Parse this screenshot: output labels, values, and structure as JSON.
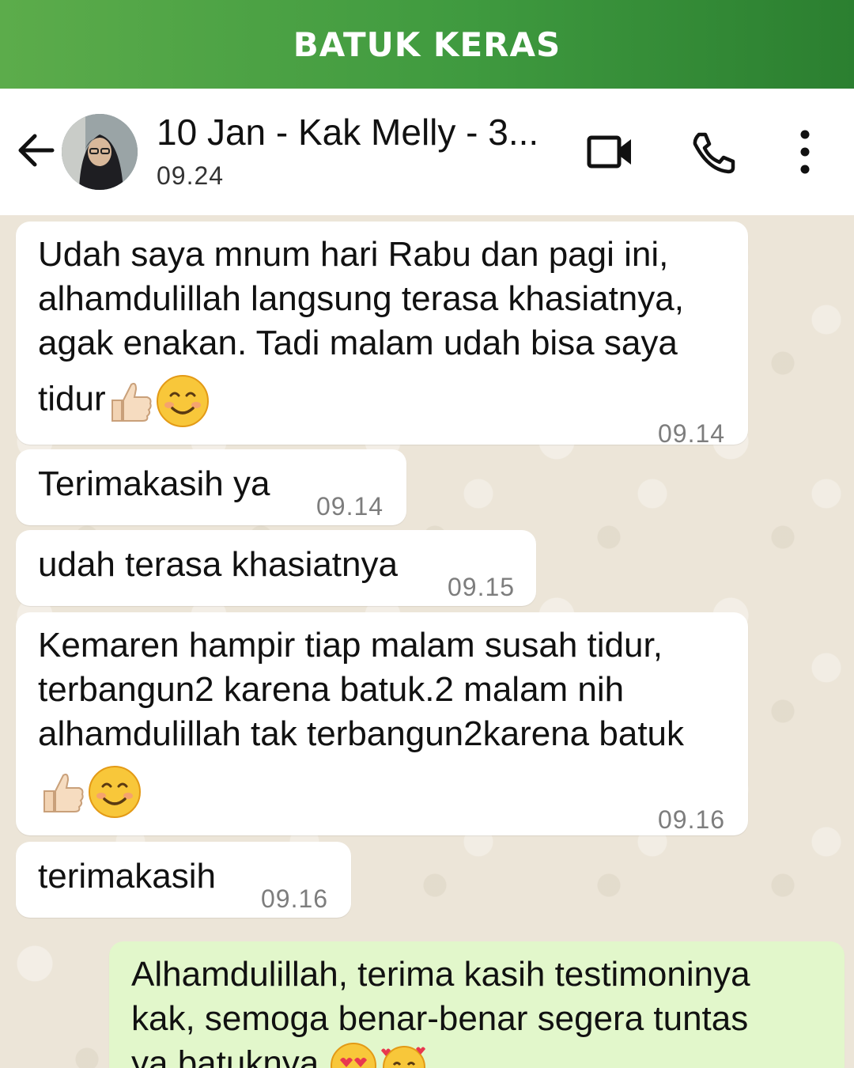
{
  "banner": {
    "title": "BATUK KERAS"
  },
  "header": {
    "contact_name": "10 Jan - Kak Melly - 3...",
    "last_seen": "09.24",
    "icons": [
      "back-arrow-icon",
      "video-call-icon",
      "phone-icon",
      "more-vert-icon"
    ]
  },
  "messages": [
    {
      "direction": "incoming",
      "lines": [
        "Udah saya mnum hari Rabu dan pagi ini,",
        "alhamdulillah langsung terasa khasiatnya,",
        "agak enakan. Tadi malam udah bisa saya",
        "tidur"
      ],
      "emojis": [
        "thumbs-up-icon",
        "smiling-face-icon"
      ],
      "time": "09.14"
    },
    {
      "direction": "incoming",
      "text": "Terimakasih ya",
      "time": "09.14"
    },
    {
      "direction": "incoming",
      "text": "udah terasa khasiatnya",
      "time": "09.15"
    },
    {
      "direction": "incoming",
      "lines": [
        "Kemaren hampir tiap  malam susah tidur,",
        "terbangun2 karena batuk.2 malam  nih",
        "alhamdulillah tak terbangun2karena batuk"
      ],
      "emojis": [
        "thumbs-up-icon",
        "smiling-face-icon"
      ],
      "time": "09.16"
    },
    {
      "direction": "incoming",
      "text": "terimakasih",
      "time": "09.16"
    },
    {
      "direction": "outgoing",
      "lines": [
        "Alhamdulillah, terima kasih testimoninya",
        "kak, semoga benar-benar segera tuntas",
        "ya batuknya"
      ],
      "emojis": [
        "heart-eyes-icon",
        "smiling-face-with-hearts-icon"
      ]
    }
  ],
  "colors": {
    "banner_green": "#3f9a3f",
    "incoming_bubble": "#ffffff",
    "outgoing_bubble": "#e2f7cb",
    "chat_background": "#ece5d8"
  }
}
